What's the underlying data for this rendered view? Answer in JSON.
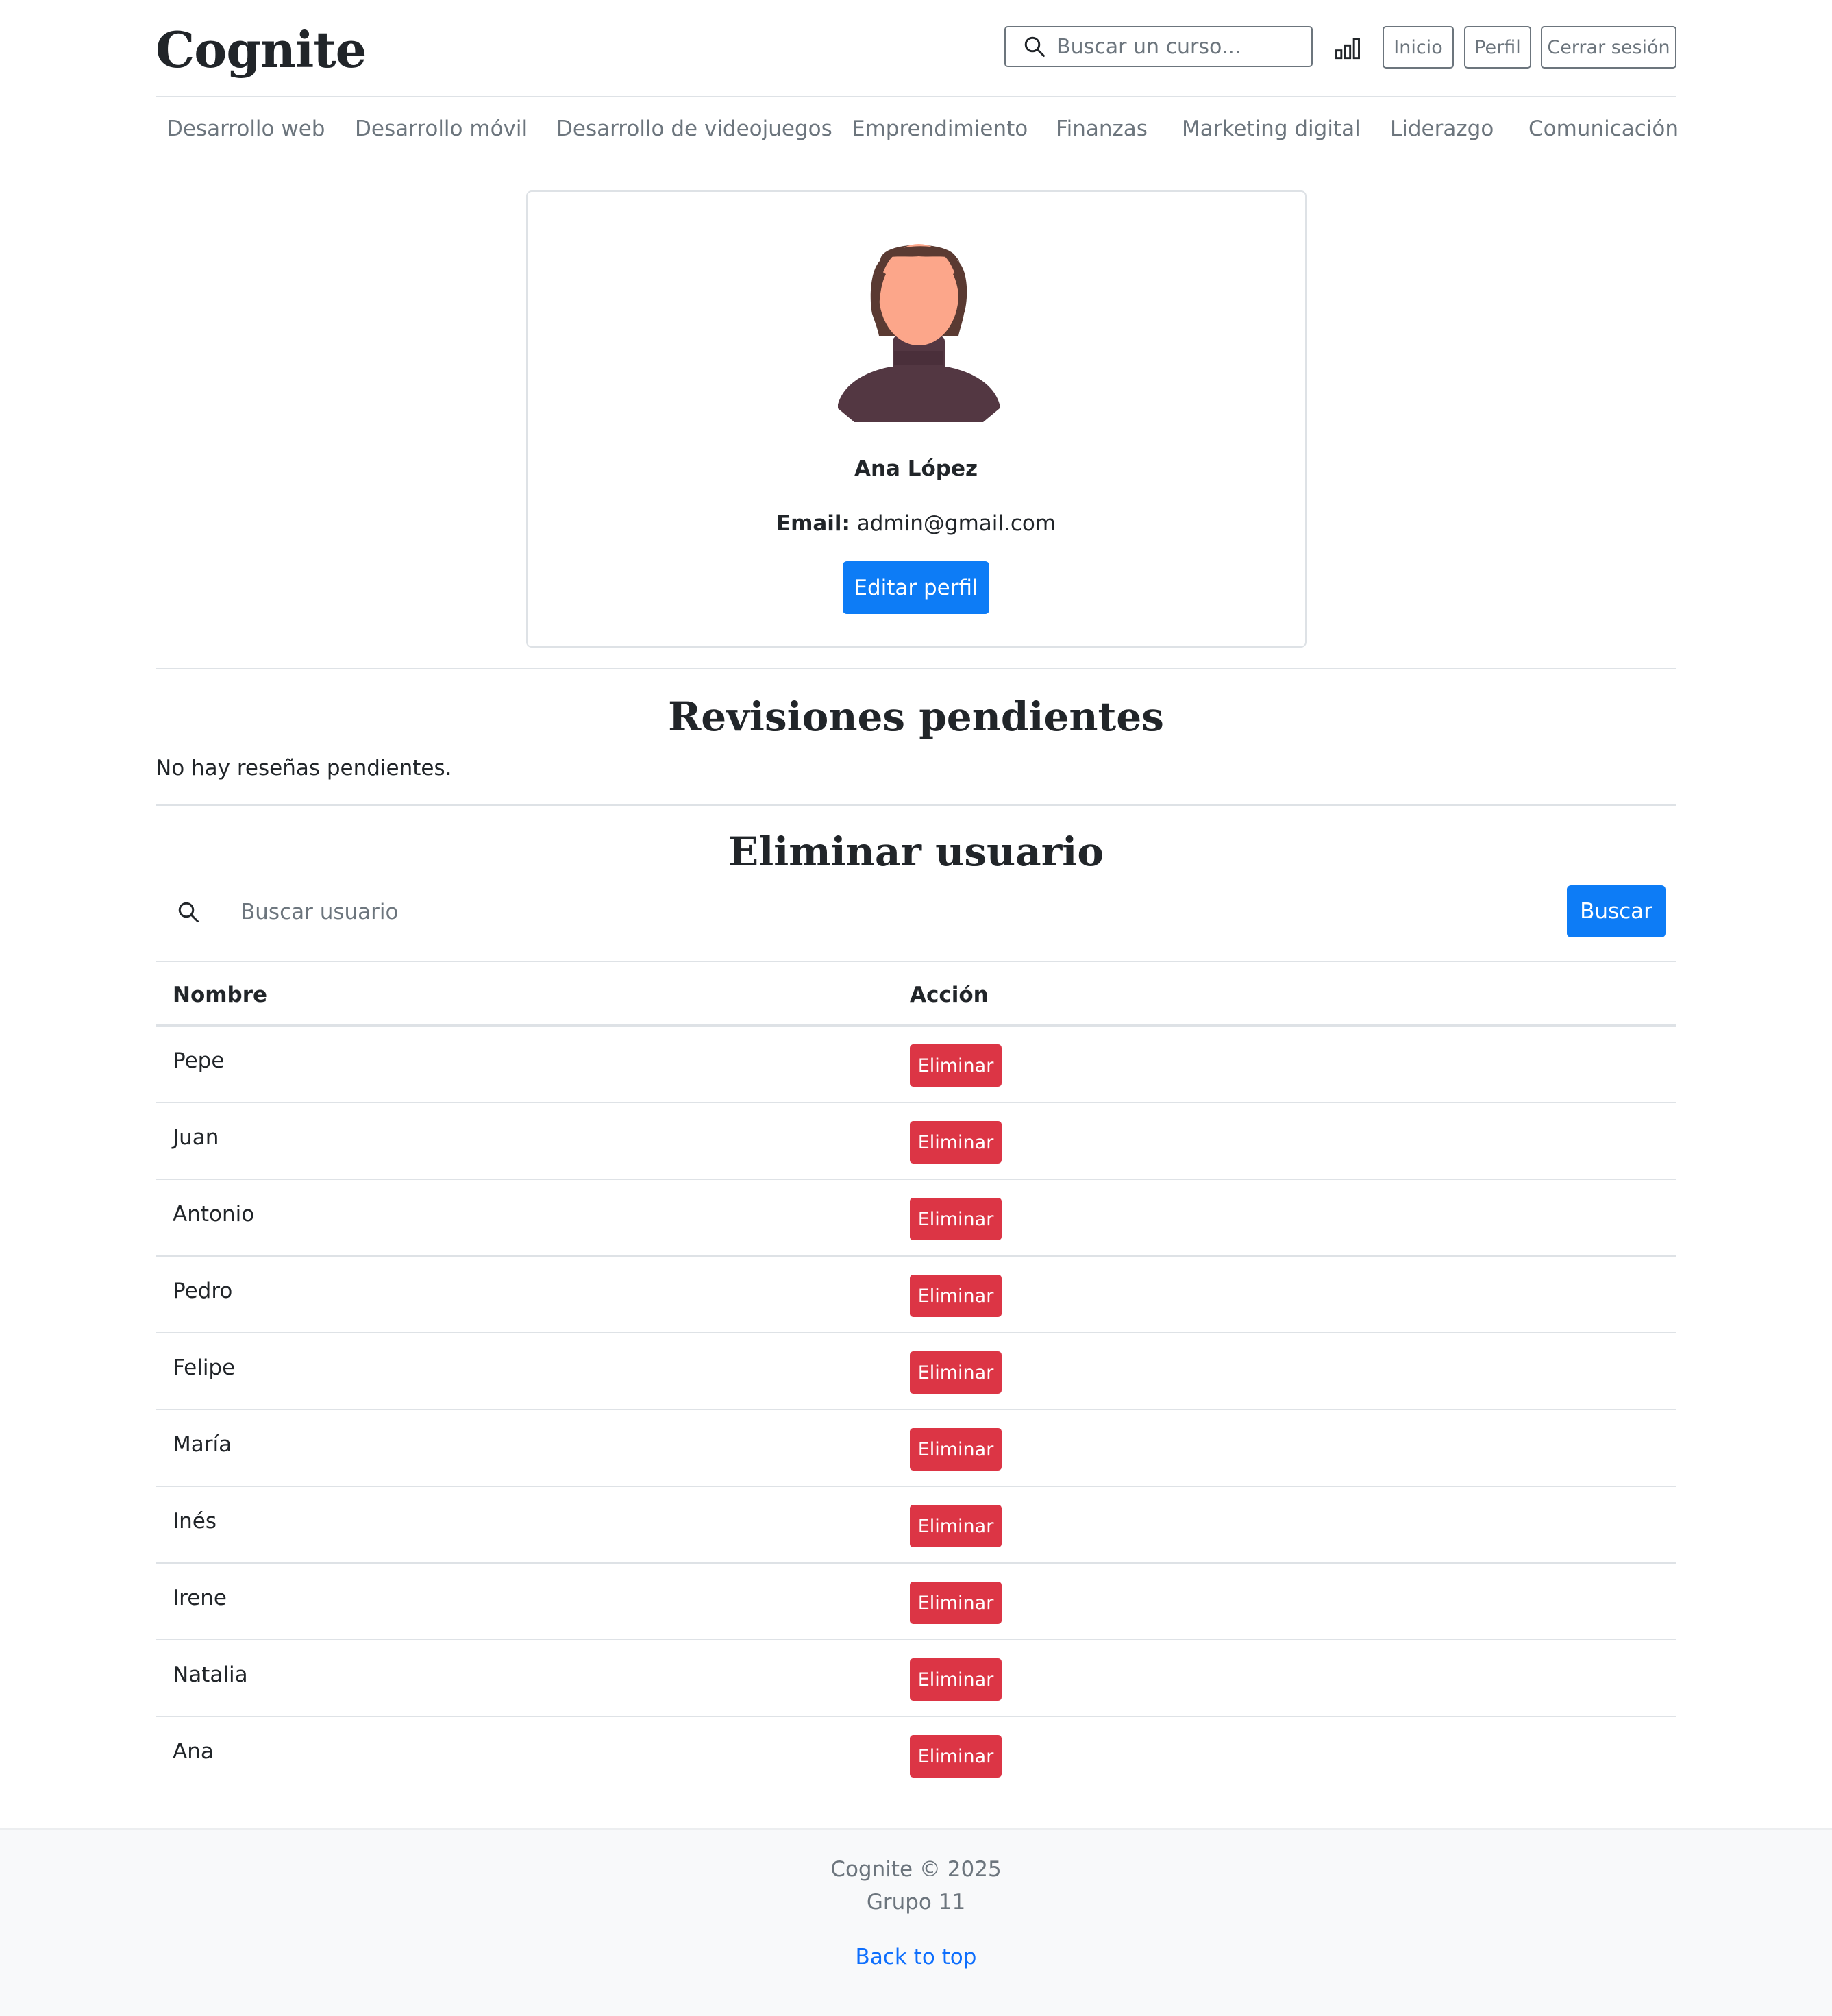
{
  "brand": {
    "logo": "Cognite"
  },
  "header": {
    "search_placeholder": "Buscar un curso...",
    "buttons": {
      "home": "Inicio",
      "profile": "Perfil",
      "logout": "Cerrar sesión"
    }
  },
  "categories": [
    "Desarrollo web",
    "Desarrollo móvil",
    "Desarrollo de videojuegos",
    "Emprendimiento",
    "Finanzas",
    "Marketing digital",
    "Liderazgo",
    "Comunicación"
  ],
  "profile": {
    "name": "Ana López",
    "email_label": "Email:",
    "email": "admin@gmail.com",
    "edit_button": "Editar perfil"
  },
  "reviews": {
    "title": "Revisiones pendientes",
    "empty_message": "No hay reseñas pendientes."
  },
  "delete_user": {
    "title": "Eliminar usuario",
    "search_placeholder": "Buscar usuario",
    "search_button": "Buscar",
    "columns": {
      "name": "Nombre",
      "action": "Acción"
    },
    "action_label": "Eliminar",
    "users": [
      "Pepe",
      "Juan",
      "Antonio",
      "Pedro",
      "Felipe",
      "María",
      "Inés",
      "Irene",
      "Natalia",
      "Ana"
    ]
  },
  "footer": {
    "copyright": "Cognite © 2025",
    "group": "Grupo 11",
    "back_to_top": "Back to top"
  },
  "colors": {
    "primary": "#0d7cf6",
    "danger": "#dc3545",
    "muted": "#6c757d",
    "link": "#0d6efd"
  }
}
